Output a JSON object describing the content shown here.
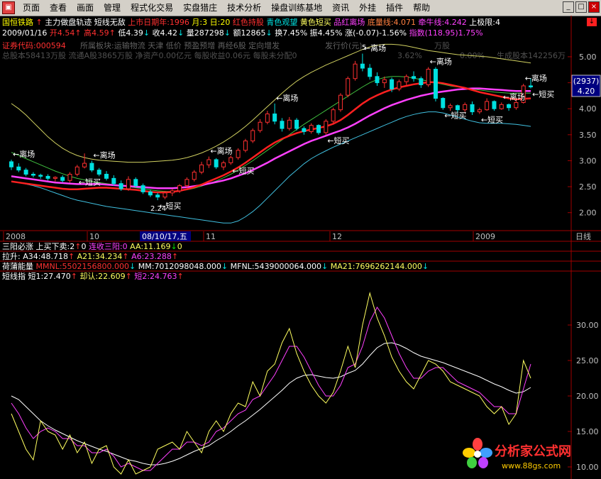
{
  "menu": {
    "icon_label": "",
    "items": [
      "页面",
      "查看",
      "画面",
      "管理",
      "程式化交易",
      "实盘猎庄",
      "技术分析",
      "操盘训练基地",
      "资讯",
      "外挂",
      "插件",
      "帮助"
    ],
    "window_buttons": [
      "_",
      "□",
      "×"
    ]
  },
  "header": {
    "stock_name": "国恒铁路",
    "indicator1": "主力做盘轨迹",
    "indicator2": "短线无敌",
    "listing_days": "上市日期年:1996",
    "month": "月:3",
    "day": "日:20",
    "red_hold": "红色持股",
    "cyan_watch": "青色观望",
    "yellow_short": "黄色短买",
    "purple_leave": "品红离场",
    "bottom_line": "底量线:4.071",
    "bull_line": "牵牛线:4.242",
    "upper_limit": "上极限:4",
    "arrow_down": "↓"
  },
  "quote": {
    "date": "2009/01/16",
    "open": "开4.54",
    "high": "高4.59",
    "low": "低4.39",
    "close": "收4.42",
    "volume": "量287298",
    "amount": "额12865",
    "change": "换7.45%",
    "amplitude": "振4.45%",
    "rise": "涨(-0.07)-1.56%",
    "index": "指数(118.95)1.75%"
  },
  "info": {
    "code_line": "证券代码:000594",
    "sector_line": "所属板块:运输物流 天津 低价 预盈预增 再经6股 定向增发",
    "issue_line": "发行价(元)",
    "share_line": "总股本58413万股 流通A股3865万股 净资产0.00亿元 每股收益0.06元 每股未分配0",
    "faint_right1": "3.62%",
    "faint_right2": "0.00%",
    "faint_right3": "万股",
    "faint_right4": "生成股本142256万"
  },
  "price_axis": {
    "ticks": [
      "5.00",
      "4.50",
      "4.00",
      "3.50",
      "3.00",
      "2.50",
      "2.00"
    ],
    "tick_values": [
      5.0,
      4.5,
      4.0,
      3.5,
      3.0,
      2.5,
      2.0
    ],
    "current_badge_top": "(2937)",
    "current_badge_bottom": "4.20"
  },
  "annotations": {
    "leave": "离场",
    "short_buy": "短买",
    "low_label": "2.24",
    "high_label": "5"
  },
  "date_axis": {
    "labels": [
      "2008",
      "10",
      "11",
      "12",
      "2009"
    ],
    "cursor_date": "08/10/17,五",
    "period": "日线"
  },
  "panel2": {
    "title": "三阳必涨",
    "buy_sell": "上买下卖:2",
    "buy_sell_v": "0",
    "streak": "连收三阳:0",
    "aa": "AA:11.169",
    "aa_v": "0"
  },
  "panel3": {
    "title": "拉升:",
    "a34": "A34:48.718",
    "a21": "A21:34.234",
    "a6": "A6:23.288"
  },
  "panel4": {
    "title": "荷蒲能量",
    "mmnl": "MMNL:5502156800.000",
    "mm": "MM:7012098048.000",
    "mfnl": "MFNL:5439000064.000",
    "ma21": "MA21:7696262144.000"
  },
  "panel5": {
    "title": "短线指",
    "short1": "短1:27.470",
    "confirm": "却认:22.609",
    "short2": "短2:24.763",
    "ticks": [
      "30.00",
      "25.00",
      "20.00",
      "15.00",
      "10.00"
    ],
    "tick_values": [
      30,
      25,
      20,
      15,
      10
    ]
  },
  "logo": {
    "name": "分析家公式网",
    "url": "www.88gs.com"
  },
  "colors": {
    "up": "#ff3030",
    "down": "#00e0e0",
    "yellow": "#ffff60",
    "magenta": "#ff40ff",
    "red_line": "#ff2020",
    "green_line": "#40c040",
    "cyan_line": "#40c0e0",
    "upper_band": "#d0d060"
  },
  "chart_data": {
    "type": "candlestick",
    "ohlc": [
      [
        2.98,
        3.02,
        2.82,
        2.88
      ],
      [
        2.88,
        2.95,
        2.78,
        2.82
      ],
      [
        2.82,
        2.86,
        2.7,
        2.74
      ],
      [
        2.74,
        2.78,
        2.68,
        2.72
      ],
      [
        2.72,
        2.75,
        2.65,
        2.7
      ],
      [
        2.7,
        2.74,
        2.62,
        2.66
      ],
      [
        2.66,
        2.7,
        2.6,
        2.68
      ],
      [
        2.68,
        2.72,
        2.58,
        2.62
      ],
      [
        2.62,
        2.78,
        2.58,
        2.74
      ],
      [
        2.74,
        2.92,
        2.7,
        2.88
      ],
      [
        2.88,
        3.14,
        2.85,
        2.95
      ],
      [
        2.95,
        3.0,
        2.78,
        2.82
      ],
      [
        2.82,
        2.86,
        2.7,
        2.74
      ],
      [
        2.74,
        2.8,
        2.62,
        2.66
      ],
      [
        2.66,
        2.72,
        2.52,
        2.56
      ],
      [
        2.56,
        2.62,
        2.42,
        2.46
      ],
      [
        2.46,
        2.7,
        2.42,
        2.64
      ],
      [
        2.64,
        2.68,
        2.48,
        2.52
      ],
      [
        2.52,
        2.56,
        2.36,
        2.4
      ],
      [
        2.4,
        2.44,
        2.3,
        2.34
      ],
      [
        2.34,
        2.38,
        2.24,
        2.3
      ],
      [
        2.3,
        2.42,
        2.26,
        2.38
      ],
      [
        2.38,
        2.46,
        2.32,
        2.42
      ],
      [
        2.42,
        2.55,
        2.38,
        2.52
      ],
      [
        2.52,
        2.68,
        2.48,
        2.64
      ],
      [
        2.64,
        2.82,
        2.6,
        2.78
      ],
      [
        2.78,
        2.98,
        2.74,
        2.92
      ],
      [
        2.92,
        3.08,
        2.86,
        3.02
      ],
      [
        3.02,
        3.05,
        2.84,
        2.88
      ],
      [
        2.88,
        3.0,
        2.82,
        2.96
      ],
      [
        2.96,
        3.1,
        2.92,
        3.06
      ],
      [
        3.06,
        3.24,
        3.02,
        3.2
      ],
      [
        3.2,
        3.42,
        3.16,
        3.38
      ],
      [
        3.38,
        3.62,
        3.34,
        3.58
      ],
      [
        3.58,
        3.8,
        3.54,
        3.74
      ],
      [
        3.74,
        3.96,
        3.7,
        3.9
      ],
      [
        3.9,
        4.1,
        3.7,
        3.76
      ],
      [
        3.76,
        3.82,
        3.56,
        3.62
      ],
      [
        3.62,
        3.84,
        3.58,
        3.78
      ],
      [
        3.78,
        3.82,
        3.58,
        3.62
      ],
      [
        3.62,
        3.66,
        3.5,
        3.56
      ],
      [
        3.56,
        3.72,
        3.52,
        3.68
      ],
      [
        3.68,
        3.7,
        3.5,
        3.54
      ],
      [
        3.54,
        3.8,
        3.5,
        3.76
      ],
      [
        3.76,
        4.02,
        3.72,
        3.98
      ],
      [
        3.98,
        4.3,
        3.94,
        4.26
      ],
      [
        4.26,
        4.62,
        4.22,
        4.58
      ],
      [
        4.58,
        4.92,
        4.54,
        4.86
      ],
      [
        4.86,
        5.06,
        4.72,
        4.78
      ],
      [
        4.78,
        4.86,
        4.56,
        4.62
      ],
      [
        4.62,
        4.7,
        4.44,
        4.5
      ],
      [
        4.5,
        4.62,
        4.4,
        4.56
      ],
      [
        4.56,
        4.6,
        4.32,
        4.38
      ],
      [
        4.38,
        4.56,
        4.34,
        4.52
      ],
      [
        4.52,
        4.66,
        4.46,
        4.62
      ],
      [
        4.62,
        4.72,
        4.52,
        4.58
      ],
      [
        4.58,
        4.62,
        4.4,
        4.46
      ],
      [
        4.46,
        4.8,
        4.42,
        4.76
      ],
      [
        4.76,
        4.8,
        4.14,
        4.2
      ],
      [
        4.2,
        4.22,
        3.98,
        4.02
      ],
      [
        4.02,
        4.1,
        3.96,
        4.06
      ],
      [
        4.06,
        4.08,
        3.92,
        3.98
      ],
      [
        3.98,
        4.12,
        3.94,
        4.08
      ],
      [
        4.08,
        4.14,
        3.88,
        3.94
      ],
      [
        3.94,
        4.02,
        3.9,
        3.98
      ],
      [
        3.98,
        4.2,
        3.96,
        4.14
      ],
      [
        4.14,
        4.16,
        3.96,
        4.0
      ],
      [
        4.0,
        4.12,
        3.98,
        4.08
      ],
      [
        4.08,
        4.1,
        3.96,
        4.02
      ],
      [
        4.02,
        4.18,
        3.98,
        4.12
      ],
      [
        4.12,
        4.48,
        4.1,
        4.44
      ],
      [
        4.44,
        4.59,
        4.39,
        4.42
      ]
    ],
    "ma_red": [
      2.6,
      2.58,
      2.56,
      2.54,
      2.52,
      2.5,
      2.48,
      2.46,
      2.45,
      2.45,
      2.46,
      2.47,
      2.48,
      2.48,
      2.47,
      2.46,
      2.45,
      2.44,
      2.42,
      2.4,
      2.39,
      2.39,
      2.4,
      2.42,
      2.45,
      2.49,
      2.54,
      2.6,
      2.66,
      2.72,
      2.79,
      2.87,
      2.96,
      3.06,
      3.16,
      3.26,
      3.35,
      3.42,
      3.48,
      3.53,
      3.57,
      3.6,
      3.63,
      3.66,
      3.71,
      3.78,
      3.88,
      3.99,
      4.1,
      4.19,
      4.26,
      4.32,
      4.37,
      4.41,
      4.44,
      4.47,
      4.49,
      4.51,
      4.51,
      4.49,
      4.46,
      4.43,
      4.4,
      4.36,
      4.32,
      4.29,
      4.26,
      4.23,
      4.2,
      4.18,
      4.19,
      4.2
    ],
    "ma_magenta": [
      2.7,
      2.68,
      2.66,
      2.64,
      2.62,
      2.6,
      2.58,
      2.57,
      2.56,
      2.55,
      2.55,
      2.55,
      2.55,
      2.54,
      2.53,
      2.52,
      2.51,
      2.5,
      2.49,
      2.48,
      2.47,
      2.47,
      2.47,
      2.48,
      2.49,
      2.51,
      2.53,
      2.56,
      2.59,
      2.62,
      2.66,
      2.71,
      2.76,
      2.82,
      2.89,
      2.96,
      3.04,
      3.11,
      3.18,
      3.25,
      3.32,
      3.38,
      3.43,
      3.48,
      3.53,
      3.58,
      3.64,
      3.71,
      3.79,
      3.87,
      3.94,
      4.01,
      4.07,
      4.12,
      4.17,
      4.21,
      4.25,
      4.28,
      4.31,
      4.33,
      4.35,
      4.37,
      4.38,
      4.39,
      4.39,
      4.38,
      4.37,
      4.36,
      4.35,
      4.34,
      4.34,
      4.34
    ],
    "band_upper": [
      4.1,
      4.0,
      3.88,
      3.74,
      3.6,
      3.46,
      3.34,
      3.24,
      3.16,
      3.1,
      3.06,
      3.03,
      3.01,
      3.0,
      2.99,
      2.98,
      2.97,
      2.97,
      2.97,
      2.98,
      2.99,
      3.0,
      3.01,
      3.03,
      3.06,
      3.1,
      3.15,
      3.21,
      3.28,
      3.36,
      3.45,
      3.55,
      3.66,
      3.78,
      3.91,
      4.04,
      4.17,
      4.3,
      4.42,
      4.53,
      4.62,
      4.7,
      4.77,
      4.84,
      4.9,
      4.96,
      5.02,
      5.08,
      5.14,
      5.19,
      5.22,
      5.24,
      5.24,
      5.23,
      5.21,
      5.18,
      5.15,
      5.12,
      5.1,
      5.08,
      5.06,
      5.04,
      5.03,
      5.02,
      5.01,
      5.0,
      4.98,
      4.96,
      4.94,
      4.92,
      4.9,
      4.88
    ],
    "band_lower": [
      2.6,
      2.58,
      2.55,
      2.52,
      2.48,
      2.43,
      2.38,
      2.33,
      2.28,
      2.24,
      2.21,
      2.18,
      2.15,
      2.12,
      2.1,
      2.08,
      2.06,
      2.04,
      2.02,
      2.0,
      1.98,
      1.96,
      1.94,
      1.92,
      1.9,
      1.88,
      1.86,
      1.84,
      1.82,
      1.8,
      1.8,
      1.84,
      1.92,
      2.02,
      2.14,
      2.28,
      2.42,
      2.56,
      2.7,
      2.82,
      2.94,
      3.04,
      3.12,
      3.19,
      3.26,
      3.32,
      3.38,
      3.44,
      3.5,
      3.56,
      3.62,
      3.68,
      3.74,
      3.8,
      3.85,
      3.89,
      3.92,
      3.94,
      3.94,
      3.92,
      3.88,
      3.84,
      3.8,
      3.76,
      3.73,
      3.72,
      3.72,
      3.72,
      3.71,
      3.7,
      3.68,
      3.66
    ],
    "line_green": [
      3.16,
      3.1,
      3.04,
      2.98,
      2.92,
      2.86,
      2.8,
      2.75,
      2.7,
      2.66,
      2.63,
      2.6,
      2.58,
      2.56,
      2.54,
      2.52,
      2.5,
      2.48,
      2.46,
      2.44,
      2.42,
      2.41,
      2.41,
      2.42,
      2.44,
      2.47,
      2.51,
      2.56,
      2.61,
      2.67,
      2.74,
      2.82,
      2.91,
      3.0,
      3.1,
      3.2,
      3.3,
      3.4,
      3.5,
      3.6,
      3.7,
      3.79,
      3.88,
      3.97,
      4.06,
      4.15,
      4.24,
      4.33,
      4.42,
      4.5,
      4.56,
      4.6,
      4.62,
      4.62,
      4.61,
      4.59,
      4.56,
      4.53,
      4.5,
      4.47,
      4.44,
      4.42,
      4.4,
      4.38,
      4.36,
      4.34,
      4.32,
      4.31,
      4.3,
      4.3,
      4.3,
      4.3
    ],
    "short1": [
      17.5,
      15.0,
      12.5,
      11.0,
      16.5,
      15.0,
      14.5,
      12.5,
      14.5,
      12.0,
      13.5,
      10.5,
      12.5,
      13.0,
      10.0,
      9.0,
      11.0,
      9.0,
      9.5,
      10.0,
      12.5,
      13.0,
      13.5,
      12.5,
      15.0,
      13.5,
      12.0,
      15.0,
      16.5,
      15.0,
      17.5,
      19.0,
      18.5,
      22.0,
      20.0,
      23.5,
      24.5,
      27.5,
      29.5,
      26.0,
      23.5,
      21.5,
      20.0,
      19.0,
      20.5,
      23.5,
      27.0,
      24.0,
      30.0,
      34.5,
      31.0,
      28.5,
      25.5,
      23.5,
      22.0,
      21.0,
      23.0,
      25.0,
      24.5,
      23.5,
      22.0,
      21.5,
      21.0,
      20.5,
      20.0,
      18.5,
      17.5,
      18.5,
      16.0,
      17.5,
      25.0,
      22.5
    ],
    "short2": [
      19.0,
      17.5,
      15.5,
      14.0,
      15.0,
      15.5,
      15.0,
      14.0,
      14.0,
      13.0,
      13.0,
      12.0,
      12.0,
      12.5,
      11.5,
      10.0,
      10.5,
      10.0,
      9.5,
      9.5,
      10.5,
      11.5,
      12.5,
      12.5,
      13.5,
      13.5,
      13.0,
      13.5,
      15.0,
      15.5,
      16.5,
      17.5,
      18.0,
      19.5,
      20.0,
      21.5,
      23.0,
      25.0,
      27.0,
      27.0,
      25.5,
      23.5,
      21.5,
      20.0,
      20.0,
      21.5,
      24.0,
      24.5,
      27.0,
      30.5,
      32.5,
      31.0,
      28.5,
      26.0,
      24.0,
      22.5,
      22.5,
      23.5,
      24.0,
      24.0,
      23.0,
      22.0,
      21.5,
      21.0,
      20.5,
      19.5,
      18.5,
      18.5,
      17.5,
      17.5,
      21.0,
      24.5
    ],
    "confirm": [
      20.0,
      19.5,
      18.5,
      17.5,
      16.5,
      15.8,
      15.2,
      14.7,
      14.2,
      13.7,
      13.3,
      12.9,
      12.5,
      12.2,
      11.8,
      11.4,
      11.0,
      10.8,
      10.5,
      10.3,
      10.3,
      10.5,
      10.8,
      11.2,
      11.7,
      12.2,
      12.6,
      13.0,
      13.7,
      14.3,
      15.0,
      15.8,
      16.5,
      17.3,
      18.1,
      19.0,
      19.9,
      20.8,
      21.8,
      22.5,
      22.9,
      23.0,
      22.8,
      22.6,
      22.5,
      22.7,
      23.2,
      23.6,
      24.5,
      25.7,
      26.8,
      27.4,
      27.5,
      27.2,
      26.7,
      26.1,
      25.6,
      25.3,
      25.0,
      24.7,
      24.3,
      23.9,
      23.5,
      23.1,
      22.7,
      22.2,
      21.7,
      21.3,
      20.8,
      20.4,
      20.6,
      21.2
    ],
    "leave_marks": [
      0,
      11,
      27,
      36,
      48,
      57,
      67,
      70
    ],
    "buy_marks": [
      9,
      20,
      30,
      43,
      59,
      64,
      71
    ],
    "price_range": [
      1.75,
      5.3
    ],
    "short_range": [
      9.0,
      36.0
    ]
  }
}
